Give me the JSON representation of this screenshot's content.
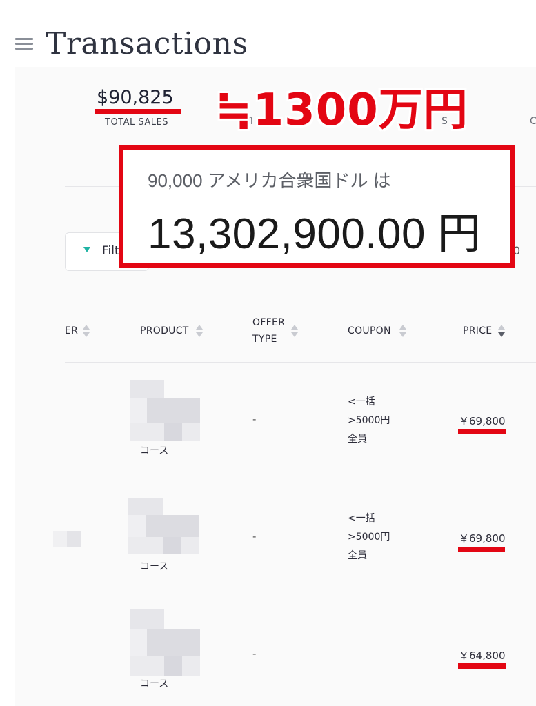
{
  "header": {
    "title": "Transactions"
  },
  "stats": {
    "total_sales_value": "$90,825",
    "total_sales_label": "TOTAL SALES",
    "partial_label_2": "ᗰ ᒪ ...S",
    "partial_label_3": "S",
    "partial_label_4": "C"
  },
  "annotation": {
    "approx_text": "≒1300万円",
    "callout_sub": "90,000 アメリカ合衆国ドル は",
    "callout_main": "13,302,900.00 円"
  },
  "toolbar": {
    "filter_label": "Filt",
    "right_partial": "0"
  },
  "table": {
    "columns": [
      "ER",
      "PRODUCT",
      "OFFER TYPE",
      "COUPON",
      "PRICE"
    ],
    "offer_type_line1": "OFFER",
    "offer_type_line2": "TYPE",
    "rows": [
      {
        "product": "コース",
        "offer_type": "-",
        "coupon": [
          "<一括",
          ">5000円",
          "全員"
        ],
        "price": "￥69,800"
      },
      {
        "product": "コース",
        "offer_type": "-",
        "coupon": [
          "<一括",
          ">5000円",
          "全員"
        ],
        "price": "￥69,800"
      },
      {
        "product": "コース",
        "offer_type": "-",
        "coupon": [],
        "price": "￥64,800"
      }
    ]
  },
  "colors": {
    "accent_red": "#e30613",
    "filter_icon": "#1fb3a4"
  },
  "icons": [
    "menu-icon",
    "filter-icon",
    "sort-icon"
  ]
}
